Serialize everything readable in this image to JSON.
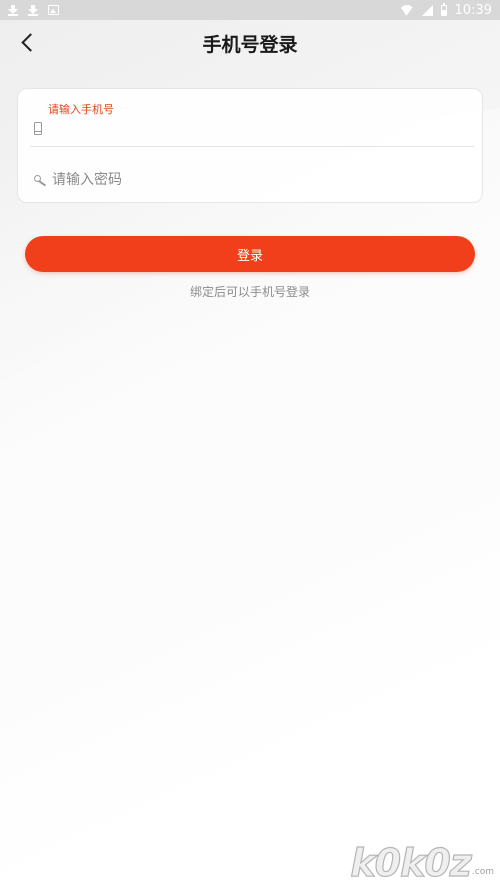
{
  "status_bar": {
    "time": "10:39",
    "left_icons": [
      "download-icon",
      "download-icon",
      "image-icon"
    ],
    "right_icons": [
      "wifi-icon",
      "signal-icon",
      "battery-icon"
    ]
  },
  "header": {
    "title": "手机号登录",
    "back_icon": "chevron-left-icon"
  },
  "form": {
    "phone_label": "请输入手机号",
    "phone_value": "",
    "phone_icon": "phone-icon",
    "password_placeholder": "请输入密码",
    "password_icon": "key-icon"
  },
  "login_button": {
    "label": "登录",
    "color": "#f23f1b"
  },
  "hint": "绑定后可以手机号登录",
  "watermark": {
    "main": "k0k0z",
    "sub": ".com"
  },
  "colors": {
    "accent": "#f23f1b",
    "label_red": "#e8421f"
  }
}
